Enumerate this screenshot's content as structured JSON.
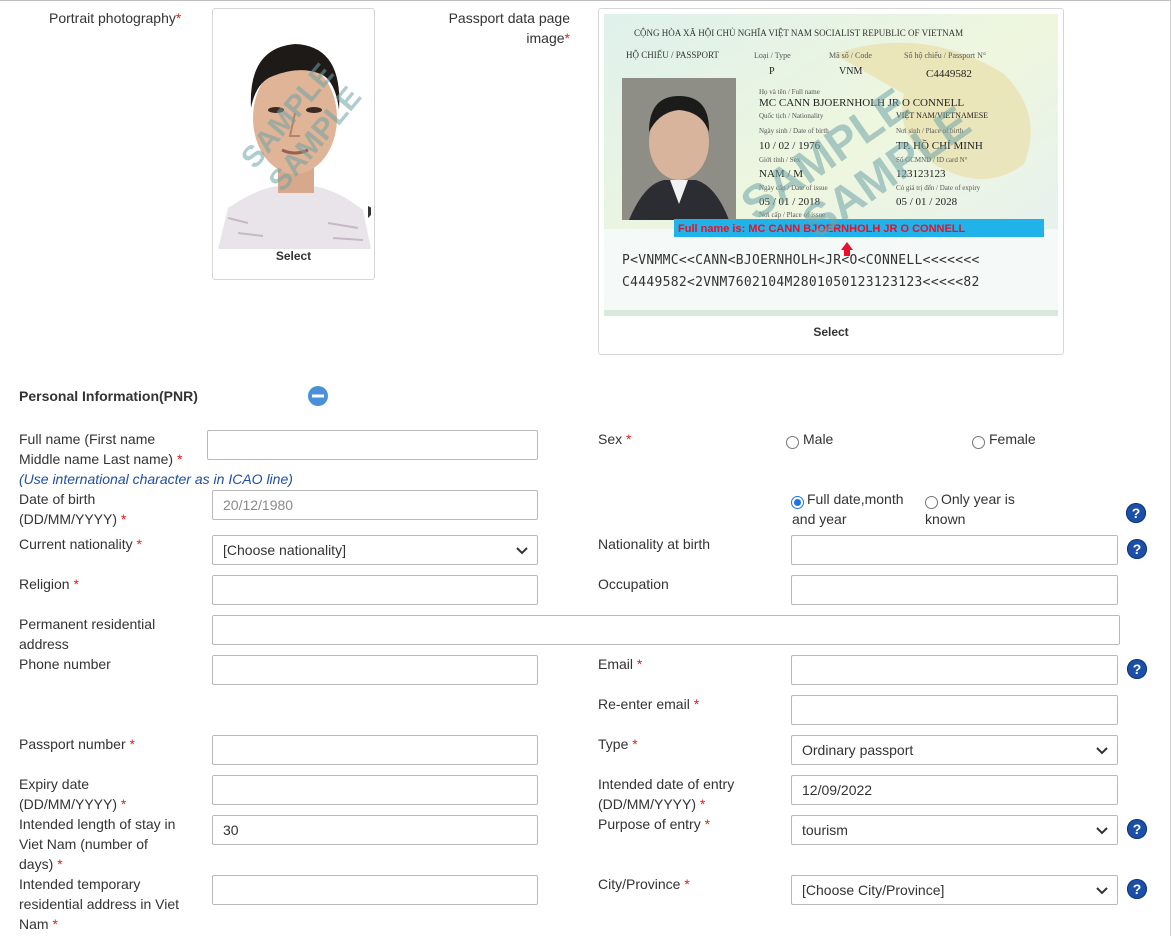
{
  "photo": {
    "label": "Portrait photography",
    "select": "Select",
    "watermark": "SAMPLE"
  },
  "passport_image": {
    "label_line1": "Passport data page",
    "label_line2": "image",
    "select": "Select",
    "watermark": "SAMPLE",
    "header": "CỘNG HÒA XÃ HỘI CHỦ NGHĨA VIỆT NAM SOCIALIST REPUBLIC OF VIETNAM",
    "passport_word": "HỘ CHIẾU / PASSPORT",
    "type_label": "Loại / Type",
    "code_label": "Mã số / Code",
    "number_label": "Số hộ chiếu / Passport N°",
    "passport_type": "P",
    "country_code": "VNM",
    "passport_no": "C4449582",
    "fullname_label": "Họ và tên / Full name",
    "fullname": "MC CANN BJOERNHOLH JR O CONNELL",
    "nationality_label": "Quốc tịch / Nationality",
    "nationality": "VIỆT NAM/VIETNAMESE",
    "dob_label": "Ngày sinh / Date of birth",
    "dob": "10 / 02 / 1976",
    "pob_label": "Nơi sinh / Place of birth",
    "pob": "TP. HỒ CHÍ MINH",
    "sex_label": "Giới tính / Sex",
    "sex": "NAM / M",
    "id_label": "Số GCMND / ID card N°",
    "id_no": "123123123",
    "issue_label": "Ngày cấp / Date of issue",
    "issue": "05 / 01 / 2018",
    "expiry_label": "Có giá trị đến / Date of expiry",
    "expiry": "05 / 01 / 2028",
    "place_issue_label": "Nơi cấp / Place of issue",
    "banner": "Full name is: MC CANN BJOERNHOLH JR O CONNELL",
    "mrz1": "P<VNMMC<<CANN<BJOERNHOLH<JR<O<CONNELL<<<<<<<",
    "mrz2": "C4449582<2VNM7602104M2801050123123123<<<<<82"
  },
  "section": {
    "title": "Personal Information(PNR)"
  },
  "form": {
    "fullname_label_1": "Full name (First name",
    "fullname_label_2": "Middle name Last name)",
    "icao_note": "(Use international character as in ICAO line)",
    "sex_label": "Sex",
    "male": "Male",
    "female": "Female",
    "dob_label_1": "Date of birth",
    "dob_label_2": "(DD/MM/YYYY)",
    "dob_placeholder": "20/12/1980",
    "dob_opt_full_1": "Full date,month",
    "dob_opt_full_2": "and year",
    "dob_opt_year_1": "Only year is",
    "dob_opt_year_2": "known",
    "nationality_label": "Current nationality",
    "nationality_value": "[Choose nationality]",
    "nationality_birth_label": "Nationality at birth",
    "religion_label": "Religion",
    "occupation_label": "Occupation",
    "address_label_1": "Permanent residential",
    "address_label_2": "address",
    "phone_label": "Phone number",
    "email_label": "Email",
    "reemail_label": "Re-enter email",
    "passport_no_label": "Passport number",
    "type_label": "Type",
    "type_value": "Ordinary passport",
    "expiry_label_1": "Expiry date",
    "expiry_label_2": "(DD/MM/YYYY)",
    "entry_label_1": "Intended date of entry",
    "entry_label_2": "(DD/MM/YYYY)",
    "entry_value": "12/09/2022",
    "stay_label_1": "Intended length of stay in",
    "stay_label_2": "Viet Nam (number of",
    "stay_label_3": "days)",
    "stay_value": "30",
    "purpose_label": "Purpose of entry",
    "purpose_value": "tourism",
    "temp_addr_label_1": "Intended temporary",
    "temp_addr_label_2": "residential address in Viet",
    "temp_addr_label_3": "Nam",
    "city_label": "City/Province",
    "city_value": "[Choose City/Province]",
    "required_mark": "*",
    "help_glyph": "?"
  },
  "colors": {
    "required": "#e02020",
    "help": "#1c4fa8",
    "note": "#1f4ea3",
    "collapse": "#4a90d9",
    "banner_bg": "#1fb3ea",
    "banner_text": "#e8102a"
  }
}
